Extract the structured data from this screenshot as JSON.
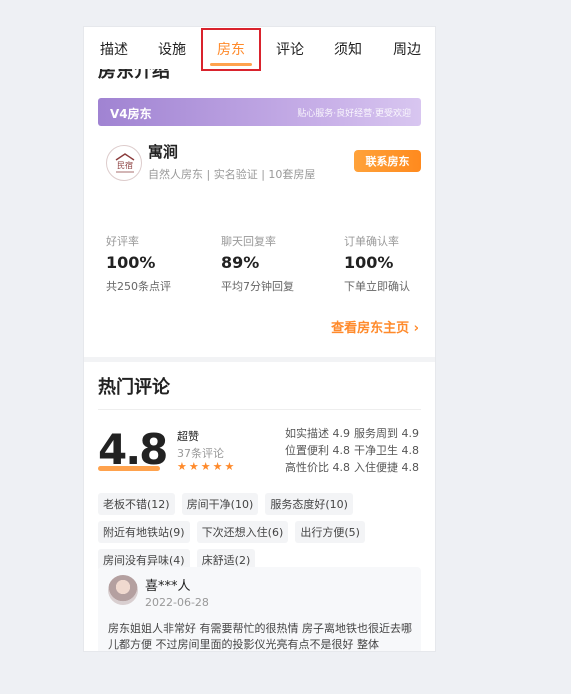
{
  "tabs": [
    "描述",
    "设施",
    "房东",
    "评论",
    "须知",
    "周边"
  ],
  "cut_section_title": "房东介绍",
  "banner": {
    "badge": "V4房东",
    "slogan": "贴心服务·良好经营·更受欢迎"
  },
  "host": {
    "logo_text": "民宿",
    "name": "寓涧",
    "subtitle": "自然人房东 | 实名验证 | 10套房屋",
    "contact_label": "联系房东"
  },
  "stats": [
    {
      "label": "好评率",
      "value": "100%",
      "sub": "共250条点评"
    },
    {
      "label": "聊天回复率",
      "value": "89%",
      "sub": "平均7分钟回复"
    },
    {
      "label": "订单确认率",
      "value": "100%",
      "sub": "下单立即确认"
    }
  ],
  "more_link": "查看房东主页",
  "reviews": {
    "title": "热门评论",
    "score": "4.8",
    "praise": "超赞",
    "count": "37条评论",
    "rating": 5,
    "sub_scores": [
      [
        "如实描述 4.9",
        "服务周到 4.9"
      ],
      [
        "位置便利 4.8",
        "干净卫生 4.8"
      ],
      [
        "高性价比 4.8",
        "入住便捷 4.8"
      ]
    ],
    "tags": [
      "老板不错(12)",
      "房间干净(10)",
      "服务态度好(10)",
      "附近有地铁站(9)",
      "下次还想入住(6)",
      "出行方便(5)",
      "房间没有异味(4)",
      "床舒适(2)"
    ],
    "first": {
      "user": "喜***人",
      "date": "2022-06-28",
      "text": "房东姐姐人非常好 有需要帮忙的很热情 房子离地铁也很近去哪儿都方便 不过房间里面的投影仪光亮有点不是很好 整体"
    }
  },
  "colors": {
    "accent": "#ff8a2b",
    "banner_purple": "#a083d2",
    "highlight_box": "#d9232d"
  }
}
